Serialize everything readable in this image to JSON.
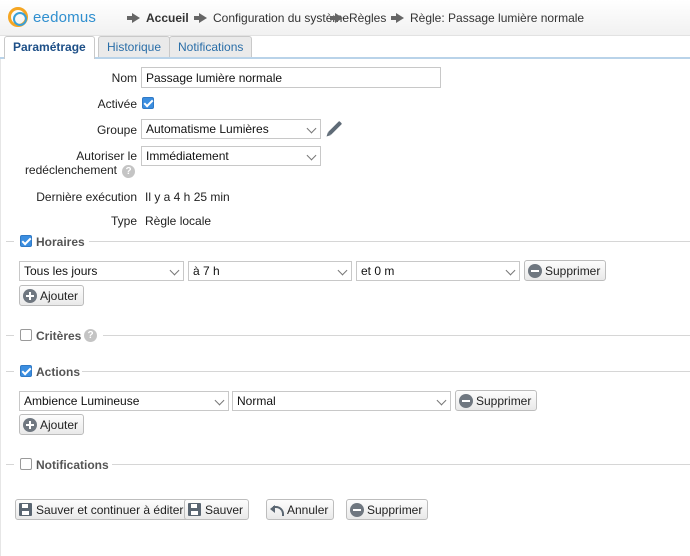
{
  "header": {
    "logo_text": "eedomus",
    "breadcrumb": [
      "Accueil",
      "Configuration du système",
      "Règles",
      "Règle: Passage lumière normale"
    ]
  },
  "tabs": [
    "Paramétrage",
    "Historique",
    "Notifications"
  ],
  "form": {
    "nom_label": "Nom",
    "nom_value": "Passage lumière normale",
    "activee_label": "Activée",
    "activee_checked": true,
    "groupe_label": "Groupe",
    "groupe_value": "Automatisme Lumières",
    "autoriser_label_1": "Autoriser le",
    "autoriser_label_2": "redéclenchement",
    "autoriser_value": "Immédiatement",
    "derniere_label": "Dernière exécution",
    "derniere_value": "Il y a 4 h 25 min",
    "type_label": "Type",
    "type_value": "Règle locale"
  },
  "horaires": {
    "title": "Horaires",
    "checked": true,
    "day": "Tous les jours",
    "hour": "à 7 h",
    "minute": "et 0 m",
    "delete_label": "Supprimer",
    "add_label": "Ajouter"
  },
  "criteres": {
    "title": "Critères",
    "checked": false
  },
  "actions": {
    "title": "Actions",
    "checked": true,
    "device": "Ambience Lumineuse",
    "value": "Normal",
    "delete_label": "Supprimer",
    "add_label": "Ajouter"
  },
  "notifications": {
    "title": "Notifications",
    "checked": false
  },
  "footer": {
    "save_continue": "Sauver et continuer à éditer",
    "save": "Sauver",
    "cancel": "Annuler",
    "delete": "Supprimer"
  },
  "colors": {
    "brand": "#2f8fcf",
    "accent": "#3b8ee0",
    "tab_text": "#2a6ea8"
  }
}
